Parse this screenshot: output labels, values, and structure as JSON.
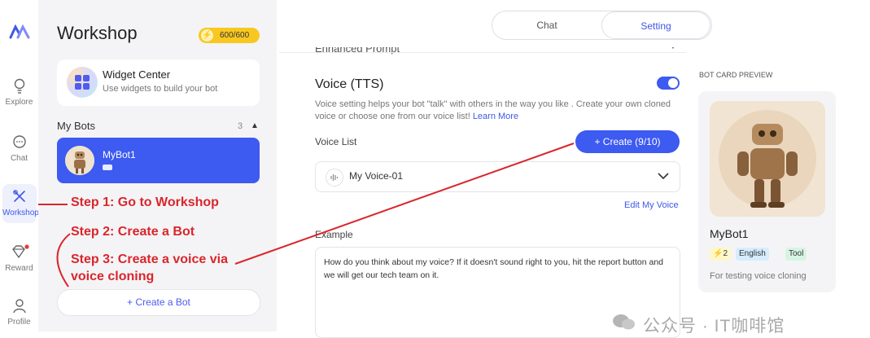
{
  "rail": {
    "items": [
      {
        "label": "Explore",
        "icon": "bulb-icon"
      },
      {
        "label": "Chat",
        "icon": "chat-bubble-icon"
      },
      {
        "label": "Workshop",
        "icon": "tools-icon",
        "active": true
      },
      {
        "label": "Reward",
        "icon": "diamond-icon"
      },
      {
        "label": "Profile",
        "icon": "user-icon"
      }
    ]
  },
  "workshop": {
    "title": "Workshop",
    "credits": "600/600",
    "widget_center": {
      "title": "Widget Center",
      "subtitle": "Use widgets to build your bot"
    },
    "my_bots_label": "My Bots",
    "my_bots_count": "3",
    "bot": {
      "name": "MyBot1"
    },
    "create_bot": "+ Create a Bot"
  },
  "annotations": {
    "step1": "Step 1: Go to Workshop",
    "step2": "Step 2: Create a Bot",
    "step3_line1": "Step 3: Create a voice via",
    "step3_line2": "voice cloning",
    "color": "#d9262c"
  },
  "tabs": {
    "chat": "Chat",
    "setting": "Setting"
  },
  "settings": {
    "enhanced_prompt": "Enhanced Prompt",
    "voice_title": "Voice (TTS)",
    "voice_enabled": true,
    "voice_desc": "Voice setting helps your bot \"talk\" with others in the way you like . Create your own cloned voice or choose one from our voice list! ",
    "learn_more": "Learn More",
    "voice_list_label": "Voice List",
    "create_voice": "+ Create (9/10)",
    "selected_voice": "My Voice-01",
    "edit_voice": "Edit My Voice",
    "example_label": "Example",
    "example_text": "How do you think about my voice?  If it doesn't sound right to you, hit the report button and we will get our tech team on it."
  },
  "preview": {
    "label": "BOT CARD PREVIEW",
    "name": "MyBot1",
    "tags": [
      "⚡2",
      "English",
      "Tool"
    ],
    "desc": "For testing voice cloning"
  },
  "watermark": "公众号 · IT咖啡馆",
  "colors": {
    "accent": "#3d5af1",
    "panel": "#f4f4f6"
  }
}
